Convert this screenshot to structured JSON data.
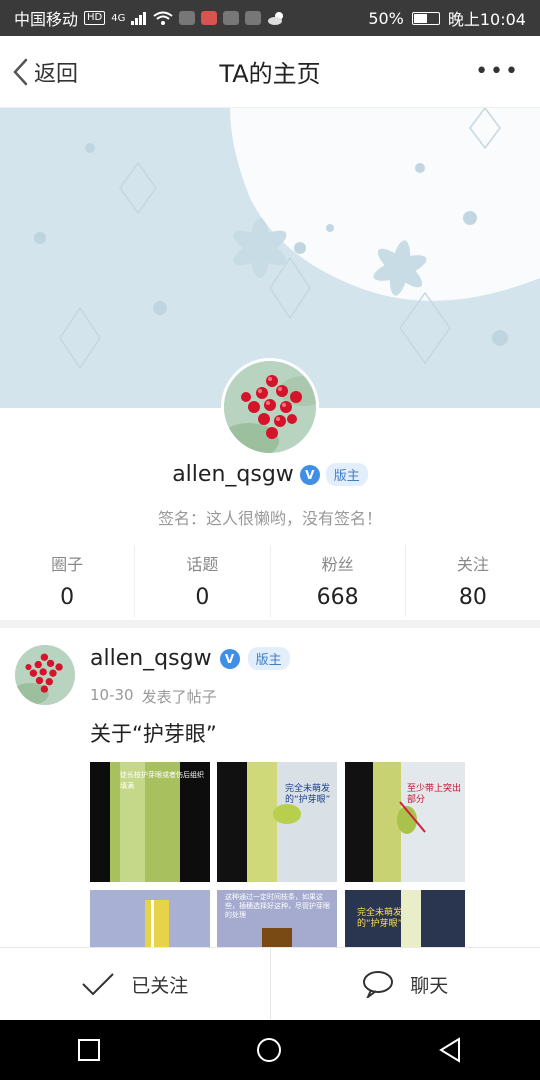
{
  "status_bar": {
    "carrier": "中国移动",
    "hd_badge": "HD",
    "network": "4G",
    "battery_text": "50%",
    "battery_level": 0.5,
    "time": "晚上10:04"
  },
  "header": {
    "back_label": "返回",
    "title": "TA的主页",
    "more_label": "•••"
  },
  "profile": {
    "username": "allen_qsgw",
    "verified_mark": "V",
    "role": "版主",
    "signature": "签名：这人很懒哟，没有签名！",
    "stats": [
      {
        "label": "圈子",
        "value": "0"
      },
      {
        "label": "话题",
        "value": "0"
      },
      {
        "label": "粉丝",
        "value": "668"
      },
      {
        "label": "关注",
        "value": "80"
      }
    ]
  },
  "post": {
    "username": "allen_qsgw",
    "verified_mark": "V",
    "role": "版主",
    "date": "10-30",
    "action": "发表了帖子",
    "title": "关于“护芽眼”",
    "images": [
      {
        "caption": "徒长枝护芽眼或者伤后组织填满"
      },
      {
        "caption": "完全未萌发的“护芽眼”"
      },
      {
        "caption": "至少带上突出部分"
      },
      {
        "caption": "这种通过一定时间枝条，如果这些，插穗选择好这种，尽管护芽眼的处理"
      },
      {
        "caption": ""
      },
      {
        "caption": "完全未萌发的“护芽眼”"
      }
    ]
  },
  "actions": {
    "follow_label": "已关注",
    "chat_label": "聊天"
  },
  "colors": {
    "accent": "#3f8fe6",
    "cover": "#d6e6ee"
  }
}
